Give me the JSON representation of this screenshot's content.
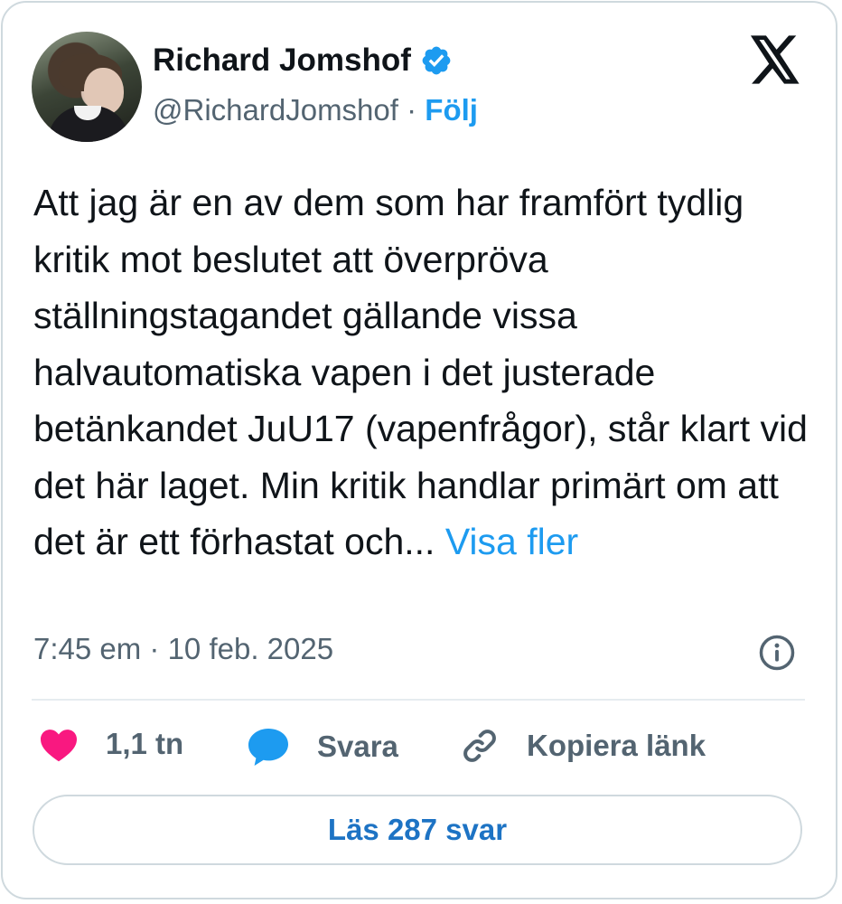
{
  "author": {
    "name": "Richard Jomshof",
    "handle": "@RichardJomshof",
    "separator": "·",
    "follow_label": "Följ",
    "verified": true
  },
  "post": {
    "text": "Att jag är en av dem som har framfört tydlig kritik mot beslutet att överpröva ställningstagandet gällande vissa halvautomatiska vapen i det justerade betänkandet JuU17 (vapenfrågor), står klart vid det här laget. Min kritik handlar primärt om att det är ett förhastat och...",
    "more_label": "Visa fler",
    "timestamp": "7:45 em · 10 feb. 2025"
  },
  "actions": {
    "likes": "1,1 tn",
    "reply_label": "Svara",
    "copy_link_label": "Kopiera länk"
  },
  "read_replies_label": "Läs 287 svar",
  "icons": {
    "verified": "verified-badge-icon",
    "platform": "x-logo-icon",
    "info": "info-icon",
    "like": "heart-icon",
    "reply": "speech-bubble-icon",
    "link": "link-icon"
  },
  "colors": {
    "accent": "#1d9bf0",
    "like": "#f91880",
    "muted": "#536471",
    "text": "#0f1419"
  }
}
